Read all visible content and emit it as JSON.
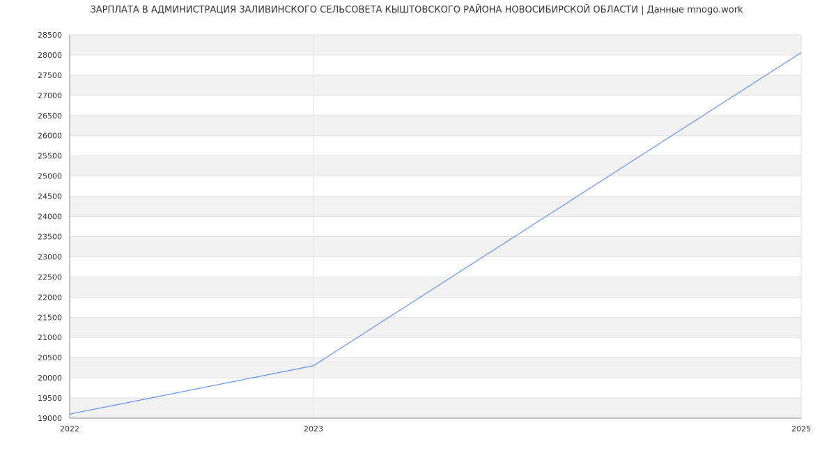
{
  "chart_data": {
    "type": "line",
    "title": "ЗАРПЛАТА В АДМИНИСТРАЦИЯ ЗАЛИВИНСКОГО СЕЛЬСОВЕТА КЫШТОВСКОГО РАЙОНА НОВОСИБИРСКОЙ ОБЛАСТИ | Данные mnogo.work",
    "xlabel": "",
    "ylabel": "",
    "x": [
      2022,
      2023,
      2025
    ],
    "x_tick_labels": [
      "2022",
      "2023",
      "2025"
    ],
    "series": [
      {
        "values": [
          19100,
          20300,
          28060
        ]
      }
    ],
    "ylim": [
      19000,
      28500
    ],
    "y_ticks": [
      19000,
      19500,
      20000,
      20500,
      21000,
      21500,
      22000,
      22500,
      23000,
      23500,
      24000,
      24500,
      25000,
      25500,
      26000,
      26500,
      27000,
      27500,
      28000,
      28500
    ],
    "grid": true,
    "alternating_band_color": "#f2f2f2",
    "grid_color": "#e0e0e0",
    "axis_color": "#888888",
    "line_color": "#6a9bef",
    "background_color": "#ffffff"
  }
}
